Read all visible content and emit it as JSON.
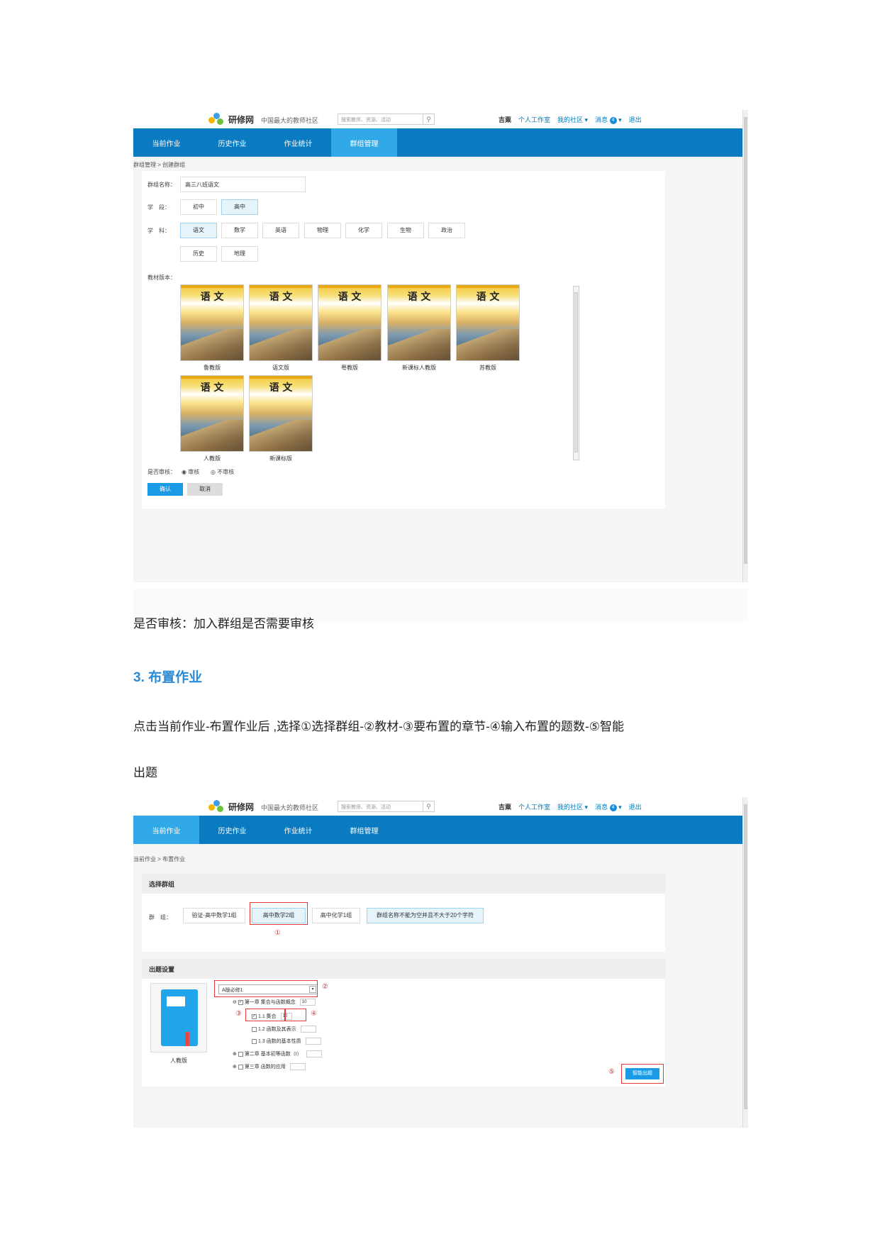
{
  "shot1": {
    "topbar": {
      "logo": "研修网",
      "slogan": "中国最大的教师社区",
      "search_placeholder": "搜索教师、资源、活动",
      "search_icon": "magnifier-icon",
      "user": "吉粟",
      "links": [
        "个人工作室",
        "我的社区",
        "消息"
      ],
      "msg_count": "4",
      "logout": "退出"
    },
    "nav": [
      "当前作业",
      "历史作业",
      "作业统计",
      "群组管理"
    ],
    "breadcrumb": "群组管理 > 创建群组",
    "form": {
      "name_label": "群组名称：",
      "name_value": "高三八班语文",
      "stage_label": "学　段：",
      "stages": [
        "初中",
        "高中"
      ],
      "subject_label": "学　科：",
      "subjects": [
        "语文",
        "数学",
        "英语",
        "物理",
        "化学",
        "生物",
        "政治",
        "历史",
        "地理"
      ],
      "textbook_label": "教材版本：",
      "book_title": "语 文",
      "books": [
        "鲁教版",
        "语文版",
        "粤教版",
        "新课标人教版",
        "苏教版",
        "人教版",
        "新课标版"
      ],
      "review_label": "是否审核：",
      "review_yes": "审核",
      "review_no": "不审核",
      "confirm": "确认",
      "cancel": "取消"
    }
  },
  "caption1": "是否审核：加入群组是否需要审核",
  "heading": "3.  布置作业",
  "para_line1": "点击当前作业-布置作业后 ,选择①选择群组-②教材-③要布置的章节-④输入布置的题数-⑤智能",
  "para_line2": "出题",
  "shot2": {
    "breadcrumb": "当前作业 > 布置作业",
    "group_section": "选择群组",
    "group_label": "群　组：",
    "groups": [
      "验证-高中数学1组",
      "高中数学2组",
      "高中化学1组",
      "群组名称不能为空并且不大于20个字符"
    ],
    "setting_section": "出题设置",
    "book_select": "A版必修1",
    "book_caption": "人教版",
    "tree": [
      {
        "label": "第一章  集合与函数概念",
        "count": "10"
      },
      {
        "label": "1.1  集合",
        "count": "10"
      },
      {
        "label": "1.2  函数及其表示",
        "count": ""
      },
      {
        "label": "1.3  函数的基本性质",
        "count": ""
      },
      {
        "label": "第二章  基本初等函数（I）",
        "count": ""
      },
      {
        "label": "第三章  函数的应用",
        "count": ""
      }
    ],
    "smart_button": "智能出题",
    "marks": [
      "①",
      "②",
      "③",
      "④",
      "⑤"
    ]
  }
}
